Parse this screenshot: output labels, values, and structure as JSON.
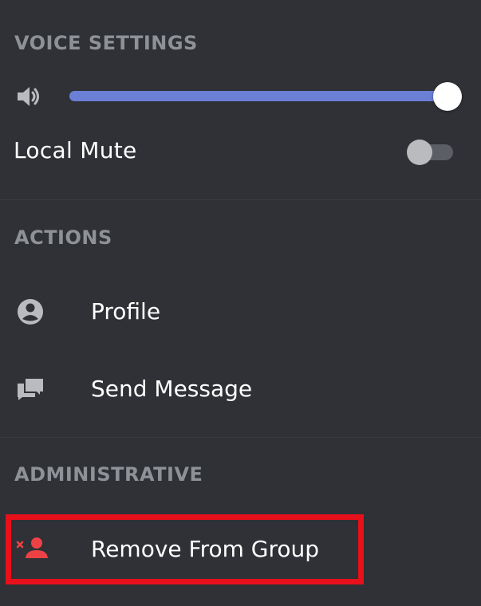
{
  "voice_settings": {
    "header": "VOICE SETTINGS",
    "volume_icon": "speaker-icon",
    "volume_level": 1.0,
    "local_mute_label": "Local Mute",
    "local_mute_on": false
  },
  "actions": {
    "header": "ACTIONS",
    "items": [
      {
        "label": "Profile",
        "icon": "profile-icon"
      },
      {
        "label": "Send Message",
        "icon": "message-icon"
      }
    ]
  },
  "administrative": {
    "header": "ADMINISTRATIVE",
    "items": [
      {
        "label": "Remove From Group",
        "icon": "remove-user-icon",
        "highlighted": true
      }
    ]
  },
  "colors": {
    "background": "#2f3136",
    "header_text": "#8e9297",
    "slider_fill": "#6b7fd6",
    "danger_icon": "#ed4245",
    "highlight_border": "#e8101a"
  }
}
